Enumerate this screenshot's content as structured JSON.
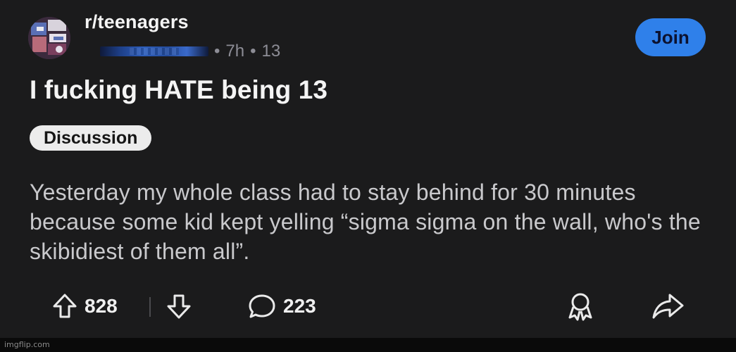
{
  "post": {
    "subreddit": "r/teenagers",
    "age": "7h",
    "extra": "13",
    "dot": "•",
    "title": "I fucking HATE being 13",
    "flair": "Discussion",
    "body": "Yesterday my whole class had to stay behind for 30 minutes because some kid kept yelling “sigma sigma on the wall, who's the skibidiest of them all”."
  },
  "actions": {
    "join_label": "Join",
    "upvotes": "828",
    "comments": "223"
  },
  "icons": {
    "upvote": "arrow-up-icon",
    "downvote": "arrow-down-icon",
    "comment": "speech-bubble-icon",
    "award": "award-ribbon-icon",
    "share": "share-arrow-icon"
  },
  "colors": {
    "background": "#1b1b1c",
    "join_button": "#2f80ea",
    "flair_chip": "#ececec",
    "meta_text": "#8d8d96"
  },
  "watermark": "imgflip.com"
}
